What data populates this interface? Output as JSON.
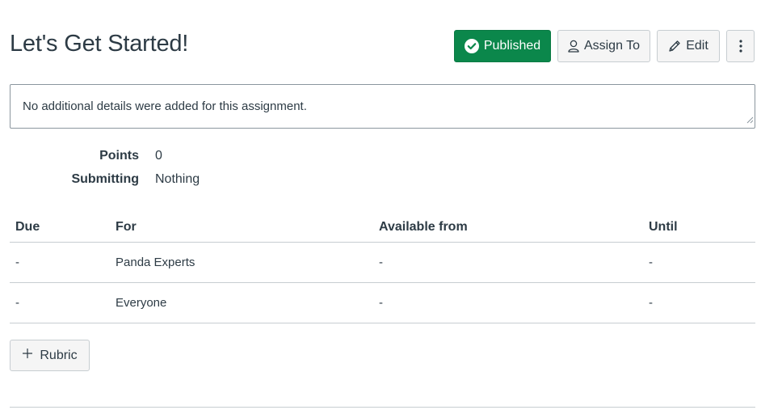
{
  "header": {
    "title": "Let's Get Started!",
    "published_label": "Published",
    "assign_to_label": "Assign To",
    "edit_label": "Edit",
    "more_icon": "kebab-menu-icon"
  },
  "description": {
    "text": "No additional details were added for this assignment."
  },
  "details": [
    {
      "label": "Points",
      "value": "0"
    },
    {
      "label": "Submitting",
      "value": "Nothing"
    }
  ],
  "dates_table": {
    "headers": [
      "Due",
      "For",
      "Available from",
      "Until"
    ],
    "rows": [
      [
        "-",
        "Panda Experts",
        "-",
        "-"
      ],
      [
        "-",
        "Everyone",
        "-",
        "-"
      ]
    ]
  },
  "rubric": {
    "label": "Rubric"
  },
  "colors": {
    "published_bg": "#0b874b",
    "text": "#2d3b45",
    "border": "#c7cdd1"
  }
}
